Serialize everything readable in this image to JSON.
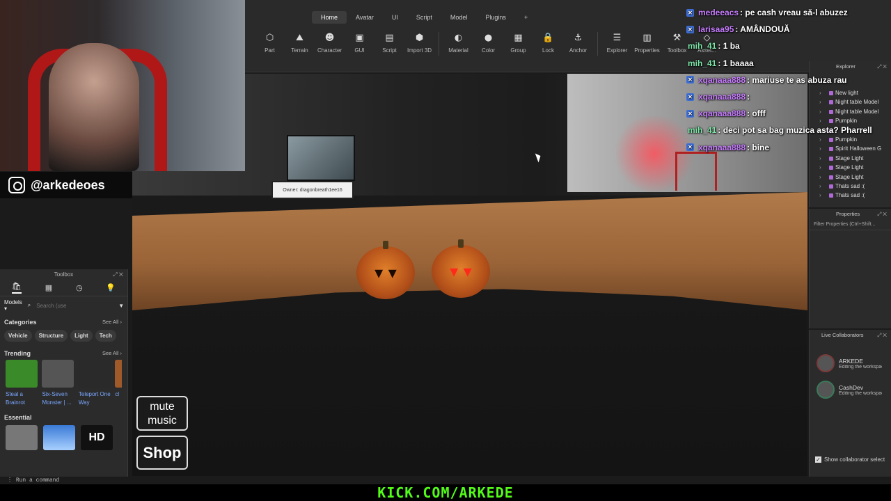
{
  "ribbon": {
    "menu_tabs": [
      "Home",
      "Avatar",
      "UI",
      "Script",
      "Model",
      "Plugins",
      "+"
    ],
    "tools": [
      {
        "label": "Part",
        "icon": "part-icon",
        "glyph": "⬡"
      },
      {
        "label": "Terrain",
        "icon": "terrain-icon",
        "glyph": "⛰"
      },
      {
        "label": "Character",
        "icon": "character-icon",
        "glyph": "☻"
      },
      {
        "label": "GUI",
        "icon": "gui-icon",
        "glyph": "▣"
      },
      {
        "label": "Script",
        "icon": "script-icon",
        "glyph": "▤"
      },
      {
        "label": "Import 3D",
        "icon": "import-3d-icon",
        "glyph": "⬢"
      },
      {
        "label": "Material",
        "icon": "material-icon",
        "glyph": "◐"
      },
      {
        "label": "Color",
        "icon": "color-icon",
        "glyph": "●"
      },
      {
        "label": "Group",
        "icon": "group-icon",
        "glyph": "▦"
      },
      {
        "label": "Lock",
        "icon": "lock-icon",
        "glyph": "🔒"
      },
      {
        "label": "Anchor",
        "icon": "anchor-icon",
        "glyph": "⚓"
      },
      {
        "label": "Explorer",
        "icon": "explorer-icon",
        "glyph": "☰"
      },
      {
        "label": "Properties",
        "icon": "properties-icon",
        "glyph": "▥"
      },
      {
        "label": "Toolbox",
        "icon": "toolbox-icon",
        "glyph": "⚒"
      },
      {
        "label": "Asset...",
        "icon": "asset-icon",
        "glyph": "◇"
      }
    ]
  },
  "stream": {
    "instagram_handle": "@arkedeoes",
    "kick_url": "KICK.COM/ARKEDE"
  },
  "viewport": {
    "sign_text": "Owner: dragonbreath1ee16",
    "mute_label_1": "mute",
    "mute_label_2": "music",
    "shop_label": "Shop"
  },
  "toolbox": {
    "title": "Toolbox",
    "category_select": "Models",
    "search_placeholder": "Search (use",
    "categories_title": "Categories",
    "see_all": "See All",
    "chips": [
      "Vehicle",
      "Structure",
      "Light",
      "Tech"
    ],
    "trending_title": "Trending",
    "trending_items": [
      {
        "name": "Steal a Brainrot",
        "color": "#3a8a2a"
      },
      {
        "name": "Six-Seven Monster | ...",
        "color": "#555555"
      },
      {
        "name": "Teleport One Way",
        "color": "#2a2a2a"
      },
      {
        "name": "cl",
        "color": "#a05a2a"
      }
    ],
    "essential_title": "Essential",
    "essential_hd": "HD"
  },
  "command_bar": {
    "placeholder": "Run a command"
  },
  "explorer": {
    "title": "Explorer",
    "items": [
      "New light",
      "Night table Model",
      "Night table Model",
      "Pumpkin",
      "",
      "Pumpkin",
      "Spirit Halloween G",
      "Stage Light",
      "Stage Light",
      "Stage Light",
      "Thats sad :(",
      "Thats sad :("
    ]
  },
  "properties": {
    "title": "Properties",
    "filter_placeholder": "Filter Properties (Ctrl+Shift..."
  },
  "collaborators": {
    "title": "Live Collaborators",
    "people": [
      {
        "name": "ARKEDE",
        "status": "Editing the workspace"
      },
      {
        "name": "CashDev",
        "status": "Editing the workspace"
      }
    ],
    "show_selection": "Show collaborator select"
  },
  "chat": [
    {
      "user": "medeeacs",
      "text": ": pe cash vreau să-l abuzez",
      "color": "#c77dff",
      "badge": true
    },
    {
      "user": "larisaa95",
      "text": ": AMÂNDOUĂ",
      "color": "#c77dff",
      "badge": true
    },
    {
      "user": "mih_41",
      "text": ": 1 ba",
      "color": "#7ee6a8",
      "badge": false
    },
    {
      "user": "mih_41",
      "text": ": 1 baaaa",
      "color": "#7ee6a8",
      "badge": false
    },
    {
      "user": "xqanaaa888",
      "text": ": mariuse te as abuza rau",
      "color": "#c77dff",
      "badge": true
    },
    {
      "user": "xqanaaa888",
      "text": ":",
      "color": "#c77dff",
      "badge": true
    },
    {
      "user": "xqanaaa888",
      "text": ": offf",
      "color": "#c77dff",
      "badge": true
    },
    {
      "user": "mih_41",
      "text": ": deci pot sa bag muzica asta? Pharrell",
      "color": "#7ee6a8",
      "badge": false
    },
    {
      "user": "xqanaaa888",
      "text": ": bine",
      "color": "#c77dff",
      "badge": true
    }
  ],
  "colors": {
    "kick_green": "#53fc18",
    "chat_badge": "#3d6fd6"
  }
}
